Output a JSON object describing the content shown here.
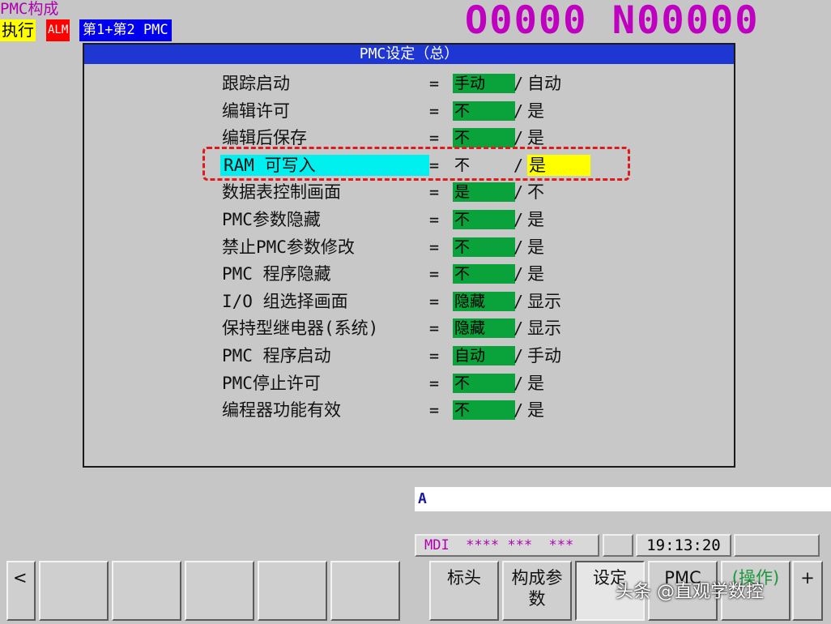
{
  "header": {
    "screen_title": "PMC构成",
    "mode_exec": "执行",
    "mode_alarm": "ALM",
    "path_label": "第1+第2 PMC",
    "program_number": "O0000 N00000"
  },
  "panel": {
    "title": "PMC设定（总）",
    "rows": [
      {
        "label": "跟踪启动",
        "eq": "=",
        "current": "手动",
        "slash": "/",
        "alt": "自动"
      },
      {
        "label": "编辑许可",
        "eq": "=",
        "current": "不",
        "slash": "/",
        "alt": "是"
      },
      {
        "label": "编辑后保存",
        "eq": "=",
        "current": "不",
        "slash": "/",
        "alt": "是"
      },
      {
        "label": "RAM 可写入",
        "eq": "=",
        "current": "不",
        "slash": "/",
        "alt": "是"
      },
      {
        "label": "数据表控制画面",
        "eq": "=",
        "current": "是",
        "slash": "/",
        "alt": "不"
      },
      {
        "label": "PMC参数隐藏",
        "eq": "=",
        "current": "不",
        "slash": "/",
        "alt": "是"
      },
      {
        "label": "禁止PMC参数修改",
        "eq": "=",
        "current": "不",
        "slash": "/",
        "alt": "是"
      },
      {
        "label": "PMC 程序隐藏",
        "eq": "=",
        "current": "不",
        "slash": "/",
        "alt": "是"
      },
      {
        "label": "I/O 组选择画面",
        "eq": "=",
        "current": "隐藏",
        "slash": "/",
        "alt": "显示"
      },
      {
        "label": "保持型继电器(系统)",
        "eq": "=",
        "current": "隐藏",
        "slash": "/",
        "alt": "显示"
      },
      {
        "label": "PMC 程序启动",
        "eq": "=",
        "current": "自动",
        "slash": "/",
        "alt": "手动"
      },
      {
        "label": "PMC停止许可",
        "eq": "=",
        "current": "不",
        "slash": "/",
        "alt": "是"
      },
      {
        "label": "编程器功能有效",
        "eq": "=",
        "current": "不",
        "slash": "/",
        "alt": "是"
      }
    ],
    "selected_row": 3
  },
  "input_line": {
    "value": "A"
  },
  "status": {
    "mode": "MDI  **** ***  ***",
    "time": "19:13:20"
  },
  "softkeys": {
    "prev": "<",
    "blank_count": 5,
    "keys": [
      "标头",
      "构成参数",
      "设定",
      "PMC ",
      "(操作)"
    ],
    "next": "+"
  },
  "watermark": "头条 @直观学数控",
  "colors": {
    "title_bar": "#1e36d2",
    "value_green": "#0aa23a",
    "selected_cyan": "#00f0f0",
    "selected_yellow": "#ffff00",
    "program_number": "#c000c0",
    "highlight_box": "#e01a1a"
  }
}
